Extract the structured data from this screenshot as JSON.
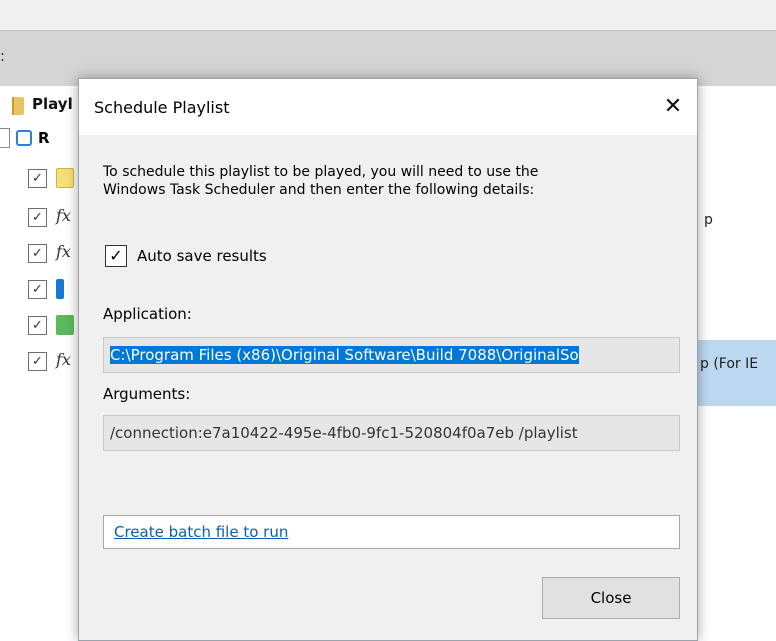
{
  "background": {
    "toolbar_glyph": ":",
    "tree_header": "Playl",
    "tree_root": "R",
    "row_check": "✓",
    "fx_symbol": "fx",
    "peek_texts": [
      "p",
      "p (For IE"
    ]
  },
  "dialog": {
    "title": "Schedule Playlist",
    "close_glyph": "✕",
    "intro_line1": "To schedule this playlist to be played, you will need to use the",
    "intro_line2": "Windows Task Scheduler and then enter the following details:",
    "auto_save": {
      "label": "Auto save results",
      "checked": true,
      "check_glyph": "✓"
    },
    "application": {
      "label": "Application:",
      "value": "C:\\Program Files (x86)\\Original Software\\Build 7088\\OriginalSo"
    },
    "arguments": {
      "label": "Arguments:",
      "value": "/connection:e7a10422-495e-4fb0-9fc1-520804f0a7eb /playlist"
    },
    "batch_link": "Create batch file to run",
    "close_button": "Close"
  },
  "colors": {
    "selection": "#0078d7",
    "link": "#0b5fb3",
    "highlight": "#bcd8f0"
  }
}
